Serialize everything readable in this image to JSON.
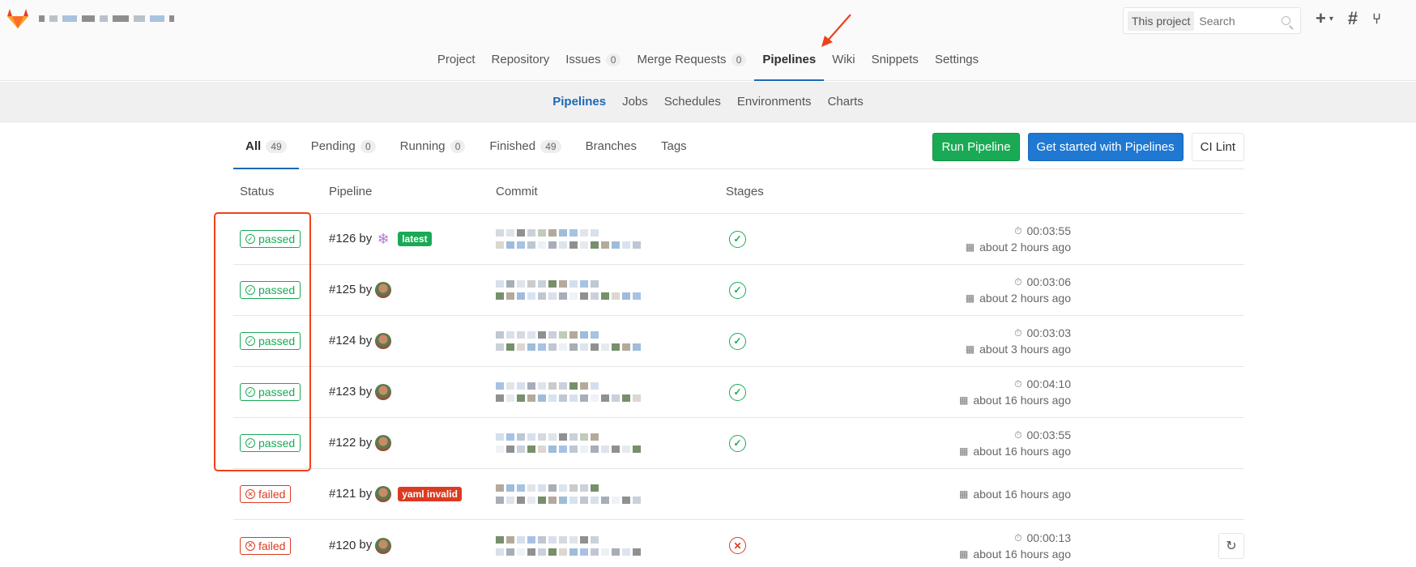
{
  "header": {
    "search_scope": "This project",
    "search_placeholder": "Search",
    "icons": [
      "plus-icon",
      "chevron-down-icon",
      "hash-icon",
      "merge-request-icon"
    ]
  },
  "main_nav": [
    {
      "label": "Project"
    },
    {
      "label": "Repository"
    },
    {
      "label": "Issues",
      "count": "0"
    },
    {
      "label": "Merge Requests",
      "count": "0"
    },
    {
      "label": "Pipelines",
      "active": true
    },
    {
      "label": "Wiki"
    },
    {
      "label": "Snippets"
    },
    {
      "label": "Settings"
    }
  ],
  "sub_nav": [
    "Pipelines",
    "Jobs",
    "Schedules",
    "Environments",
    "Charts"
  ],
  "tabs": [
    {
      "label": "All",
      "count": "49"
    },
    {
      "label": "Pending",
      "count": "0"
    },
    {
      "label": "Running",
      "count": "0"
    },
    {
      "label": "Finished",
      "count": "49"
    },
    {
      "label": "Branches"
    },
    {
      "label": "Tags"
    }
  ],
  "actions": {
    "run": "Run Pipeline",
    "get_started": "Get started with Pipelines",
    "lint": "CI Lint"
  },
  "columns": {
    "status": "Status",
    "pipeline": "Pipeline",
    "commit": "Commit",
    "stages": "Stages"
  },
  "rows": [
    {
      "status": "passed",
      "id": "#126",
      "by": "by",
      "label": "latest",
      "stage": "passed",
      "duration": "00:03:55",
      "finished": "about 2 hours ago"
    },
    {
      "status": "passed",
      "id": "#125",
      "by": "by",
      "label": "",
      "stage": "passed",
      "duration": "00:03:06",
      "finished": "about 2 hours ago"
    },
    {
      "status": "passed",
      "id": "#124",
      "by": "by",
      "label": "",
      "stage": "passed",
      "duration": "00:03:03",
      "finished": "about 3 hours ago"
    },
    {
      "status": "passed",
      "id": "#123",
      "by": "by",
      "label": "",
      "stage": "passed",
      "duration": "00:04:10",
      "finished": "about 16 hours ago"
    },
    {
      "status": "passed",
      "id": "#122",
      "by": "by",
      "label": "",
      "stage": "passed",
      "duration": "00:03:55",
      "finished": "about 16 hours ago"
    },
    {
      "status": "failed",
      "id": "#121",
      "by": "by",
      "label": "yaml invalid",
      "stage": "",
      "duration": "",
      "finished": "about 16 hours ago"
    },
    {
      "status": "failed",
      "id": "#120",
      "by": "by",
      "label": "",
      "stage": "failed",
      "duration": "00:00:13",
      "finished": "about 16 hours ago"
    }
  ],
  "colors": {
    "success": "#1aaa55",
    "danger": "#db3b21",
    "primary": "#1f78d1",
    "annotation": "#f0401c"
  }
}
